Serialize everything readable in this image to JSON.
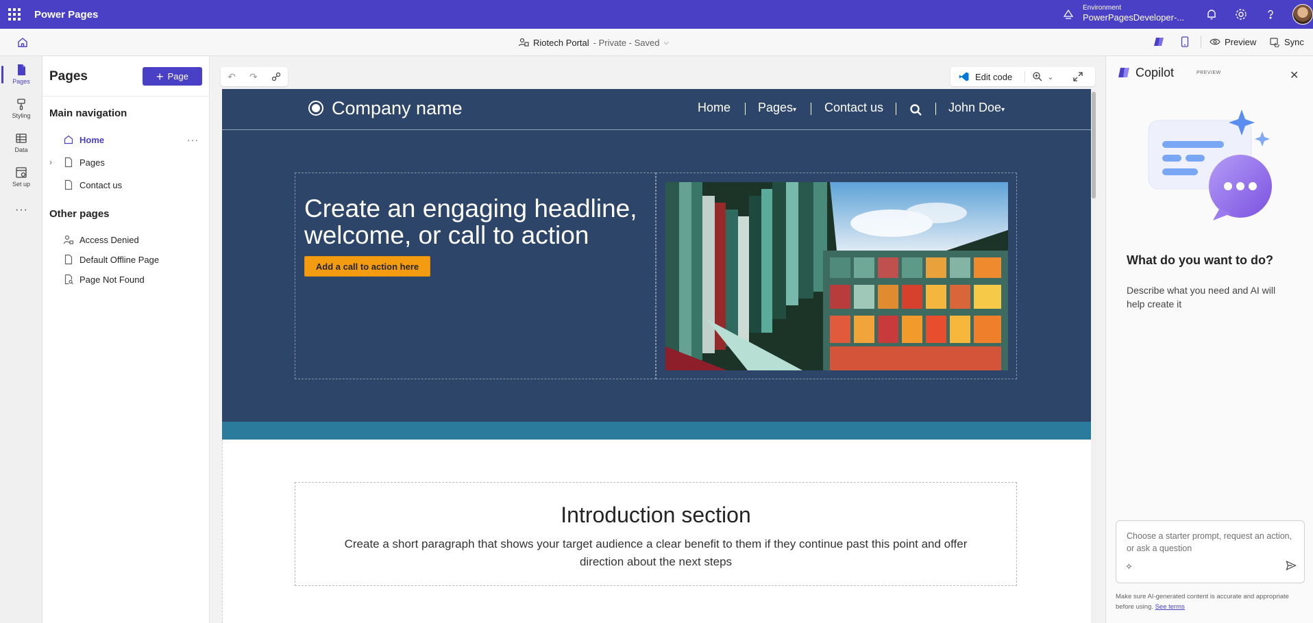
{
  "topbar": {
    "app_title": "Power Pages",
    "environment_label": "Environment",
    "environment_name": "PowerPagesDeveloper-..."
  },
  "cmdbar": {
    "site_name": "Riotech Portal",
    "site_status": "- Private - Saved",
    "preview_label": "Preview",
    "sync_label": "Sync"
  },
  "rail": {
    "items": [
      {
        "label": "Pages",
        "icon": "pages-icon"
      },
      {
        "label": "Styling",
        "icon": "brush-icon"
      },
      {
        "label": "Data",
        "icon": "table-icon"
      },
      {
        "label": "Set up",
        "icon": "setup-icon"
      }
    ]
  },
  "panel": {
    "title": "Pages",
    "add_button": "Page",
    "main_nav_heading": "Main navigation",
    "main_nav": [
      {
        "label": "Home"
      },
      {
        "label": "Pages"
      },
      {
        "label": "Contact us"
      }
    ],
    "other_heading": "Other pages",
    "other": [
      {
        "label": "Access Denied"
      },
      {
        "label": "Default Offline Page"
      },
      {
        "label": "Page Not Found"
      }
    ]
  },
  "canvas": {
    "edit_code": "Edit code"
  },
  "site": {
    "company_name": "Company name",
    "nav": {
      "home": "Home",
      "pages": "Pages",
      "contact": "Contact us",
      "user": "John Doe"
    },
    "hero_headline": "Create an engaging headline, welcome, or call to action",
    "cta": "Add a call to action here",
    "intro_title": "Introduction section",
    "intro_text": "Create a short paragraph that shows your target audience a clear benefit to them if they continue past this point and offer direction about the next steps"
  },
  "copilot": {
    "title": "Copilot",
    "tag": "PREVIEW",
    "question": "What do you want to do?",
    "description": "Describe what you need and AI will help create it",
    "input_placeholder": "Choose a starter prompt, request an action, or ask a question",
    "disclaimer": "Make sure AI-generated content is accurate and appropriate before using.",
    "terms_link": "See terms"
  },
  "colors": {
    "brand": "#4a40c5",
    "site_header": "#2c4568",
    "cta": "#f39c12",
    "teal_band": "#2b7c9c"
  }
}
